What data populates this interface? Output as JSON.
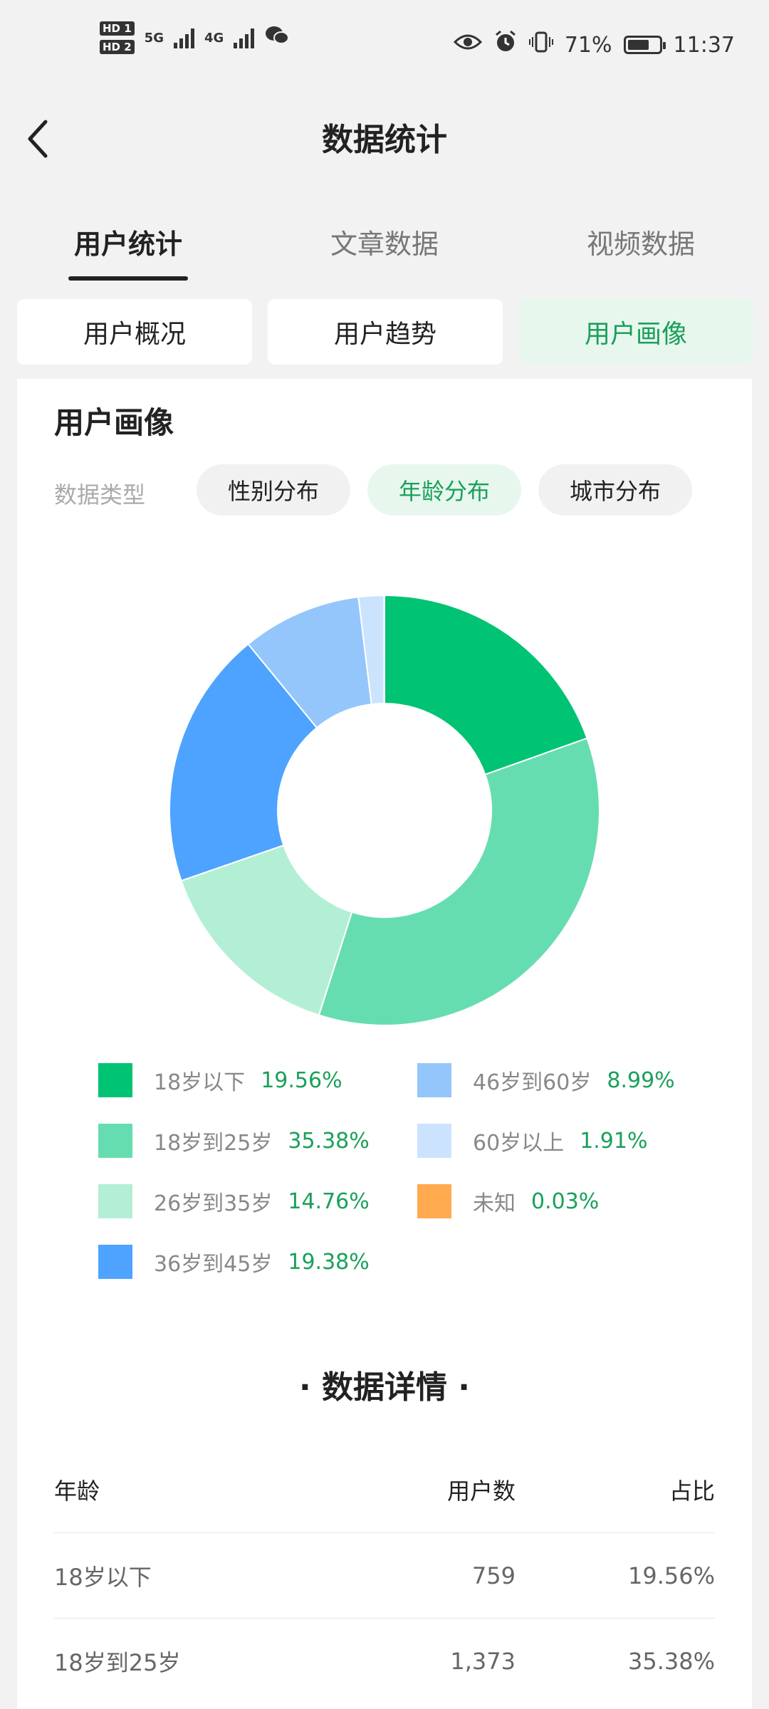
{
  "status_bar": {
    "hd1": "HD 1",
    "hd2": "HD 2",
    "net1": "5G",
    "net2": "4G",
    "battery_pct": "71%",
    "battery_level": 0.71,
    "time": "11:37",
    "icons": [
      "eye-icon",
      "alarm-icon",
      "vibrate-icon",
      "wechat-icon"
    ]
  },
  "header": {
    "title": "数据统计"
  },
  "main_tabs": [
    {
      "label": "用户统计",
      "active": true
    },
    {
      "label": "文章数据",
      "active": false
    },
    {
      "label": "视频数据",
      "active": false
    }
  ],
  "sub_tabs": [
    {
      "label": "用户概况",
      "active": false
    },
    {
      "label": "用户趋势",
      "active": false
    },
    {
      "label": "用户画像",
      "active": true
    }
  ],
  "section": {
    "title": "用户画像",
    "data_type_label": "数据类型",
    "chips": [
      {
        "label": "性别分布",
        "active": false
      },
      {
        "label": "年龄分布",
        "active": true
      },
      {
        "label": "城市分布",
        "active": false
      }
    ]
  },
  "chart_data": {
    "type": "pie",
    "categories": [
      "18岁以下",
      "18岁到25岁",
      "26岁到35岁",
      "36岁到45岁",
      "46岁到60岁",
      "60岁以上",
      "未知"
    ],
    "values": [
      19.56,
      35.38,
      14.76,
      19.38,
      8.99,
      1.91,
      0.03
    ],
    "labels_pct": [
      "19.56%",
      "35.38%",
      "14.76%",
      "19.38%",
      "8.99%",
      "1.91%",
      "0.03%"
    ],
    "colors": [
      "#00c373",
      "#66ddb0",
      "#b3efd5",
      "#4da3ff",
      "#94c6fc",
      "#cce3fd",
      "#ffaa4f"
    ],
    "legend_placement": "bottom"
  },
  "details": {
    "title": "· 数据详情 ·",
    "columns": [
      "年龄",
      "用户数",
      "占比"
    ],
    "rows": [
      {
        "age": "18岁以下",
        "users": "759",
        "ratio": "19.56%"
      },
      {
        "age": "18岁到25岁",
        "users": "1,373",
        "ratio": "35.38%"
      }
    ]
  }
}
